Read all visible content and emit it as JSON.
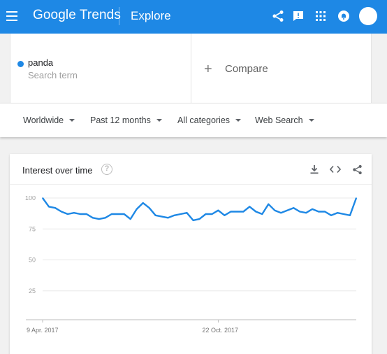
{
  "header": {
    "logo_text": "Google Trends",
    "section_title": "Explore",
    "icons": [
      "menu-icon",
      "share-icon",
      "feedback-icon",
      "apps-icon",
      "notifications-icon",
      "account-avatar"
    ],
    "accent": "#1e88e5"
  },
  "search": {
    "term": "panda",
    "term_sublabel": "Search term",
    "term_color": "#1e88e5",
    "compare_icon": "+",
    "compare_label": "Compare"
  },
  "filters": {
    "region": "Worldwide",
    "time": "Past 12 months",
    "category": "All categories",
    "property": "Web Search"
  },
  "card": {
    "title": "Interest over time",
    "help_glyph": "?",
    "actions": [
      "download-icon",
      "embed-icon",
      "share-icon"
    ]
  },
  "chart_data": {
    "type": "line",
    "title": "",
    "xlabel": "",
    "ylabel": "",
    "ylim": [
      0,
      100
    ],
    "yticks": [
      25,
      50,
      75,
      100
    ],
    "xtick_labels": [
      "9 Apr. 2017",
      "22 Oct. 2017"
    ],
    "xtick_index": [
      0,
      28
    ],
    "grid": true,
    "series": [
      {
        "color": "#1e88e5",
        "values": [
          100,
          93,
          92,
          89,
          87,
          88,
          87,
          87,
          84,
          83,
          84,
          87,
          87,
          87,
          83,
          91,
          96,
          92,
          86,
          85,
          84,
          86,
          87,
          88,
          82,
          83,
          87,
          87,
          90,
          86,
          89,
          89,
          89,
          93,
          89,
          87,
          95,
          90,
          88,
          90,
          92,
          89,
          88,
          91,
          89,
          89,
          86,
          88,
          87,
          86,
          100
        ]
      }
    ]
  }
}
